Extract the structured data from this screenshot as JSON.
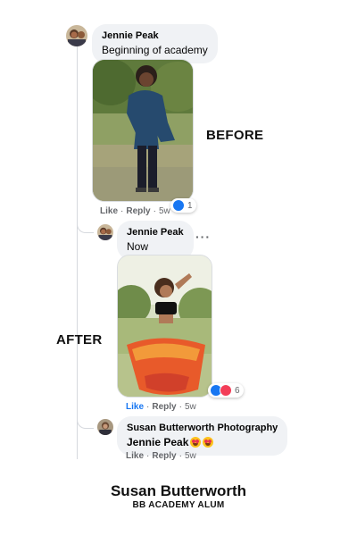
{
  "comments": [
    {
      "author": "Jennie Peak",
      "text": "Beginning of academy",
      "actions": {
        "like": "Like",
        "reply": "Reply",
        "time": "5w"
      },
      "reaction_count": "1"
    },
    {
      "author": "Jennie Peak",
      "text": "Now",
      "more": "···",
      "actions": {
        "like": "Like",
        "reply": "Reply",
        "time": "5w"
      },
      "reaction_count": "6"
    },
    {
      "author": "Susan Butterworth Photography",
      "text": "Jennie Peak",
      "actions": {
        "like": "Like",
        "reply": "Reply",
        "time": "5w"
      }
    }
  ],
  "labels": {
    "before": "BEFORE",
    "after": "AFTER"
  },
  "footer": {
    "name": "Susan Butterworth",
    "subtitle": "BB ACADEMY ALUM"
  },
  "icons": [
    "like-reaction-icon",
    "love-reaction-icon",
    "heart-eyes-emoji-icon",
    "more-options-icon"
  ],
  "colors": {
    "link_active": "#1877f2",
    "bubble": "#f0f2f5",
    "meta_text": "#65676b",
    "love": "#f33e58"
  }
}
